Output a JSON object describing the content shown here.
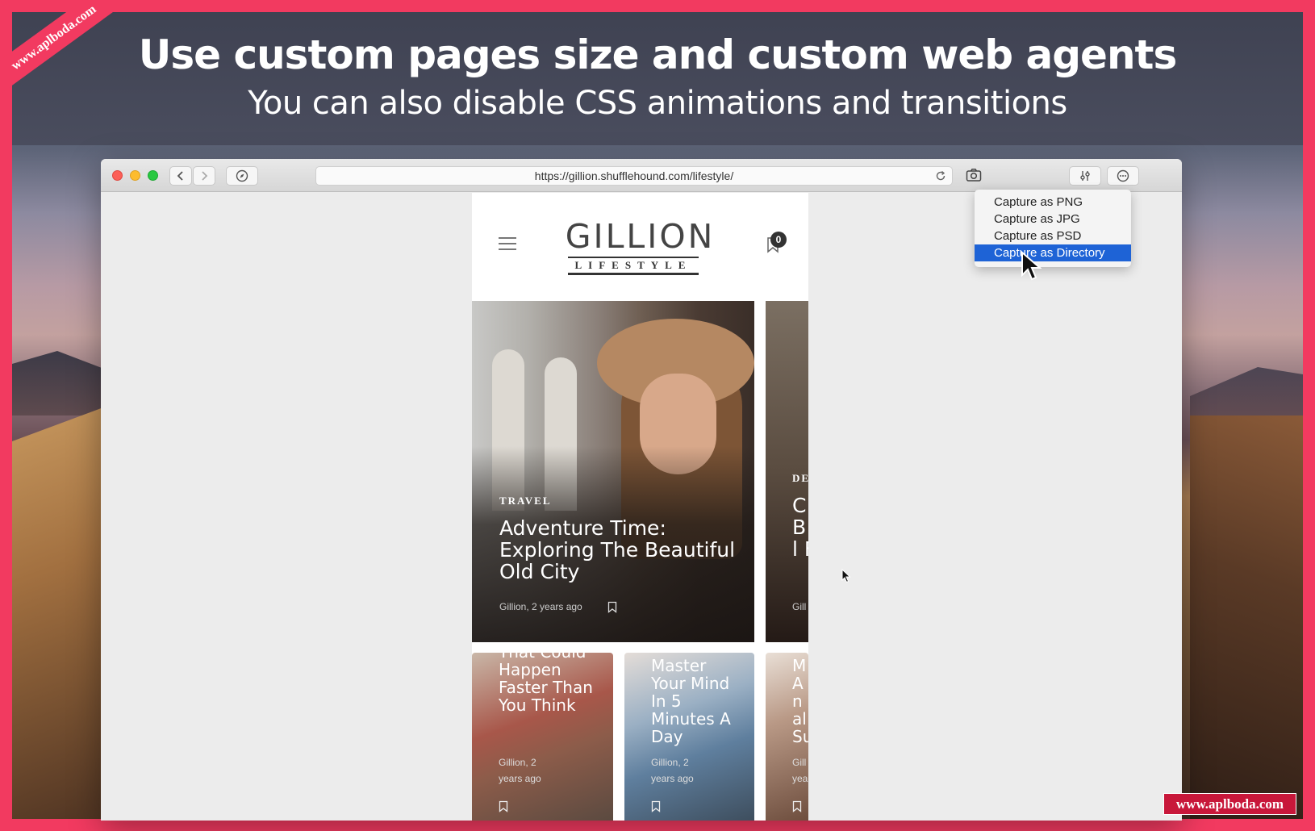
{
  "banner": {
    "title": "Use custom pages size and custom web agents",
    "subtitle": "You can also disable CSS animations and transitions"
  },
  "watermark": {
    "ribbon_text": "www.aplboda.com",
    "corner_text": "www.aplboda.com"
  },
  "browser": {
    "url": "https://gillion.shufflehound.com/lifestyle/",
    "icons": [
      "back-icon",
      "forward-icon",
      "compass-icon",
      "reload-icon",
      "camera-icon",
      "sliders-icon",
      "more-icon"
    ],
    "traffic_light_colors": [
      "#fc5f57",
      "#fdbc2e",
      "#28c840"
    ]
  },
  "capture_menu": {
    "items": [
      {
        "label": "Capture as PNG",
        "active": false
      },
      {
        "label": "Capture as JPG",
        "active": false
      },
      {
        "label": "Capture as PSD",
        "active": false
      },
      {
        "label": "Capture as Directory",
        "active": true
      }
    ],
    "highlight_color": "#1e63d6"
  },
  "site": {
    "logo_main": "GILLION",
    "logo_sub": "LIFESTYLE",
    "bookmark_count": "0",
    "hero": {
      "tag": "TRAVEL",
      "title": "Adventure Time: Exploring The Beautiful Old City",
      "meta": "Gillion, 2 years ago"
    },
    "side_card": {
      "tag": "DE",
      "title": "C B cl Fi",
      "meta": "Gill"
    },
    "cards": [
      {
        "title": "That Could Happen Faster Than You Think",
        "meta_line1": "Gillion, 2",
        "meta_line2": "years ago"
      },
      {
        "title": "Master Your Mind In 5 Minutes A Day",
        "meta_line1": "Gillion, 2",
        "meta_line2": "years ago"
      },
      {
        "title": "M A In al Su",
        "meta_line1": "Gill",
        "meta_line2": "yea"
      }
    ]
  }
}
